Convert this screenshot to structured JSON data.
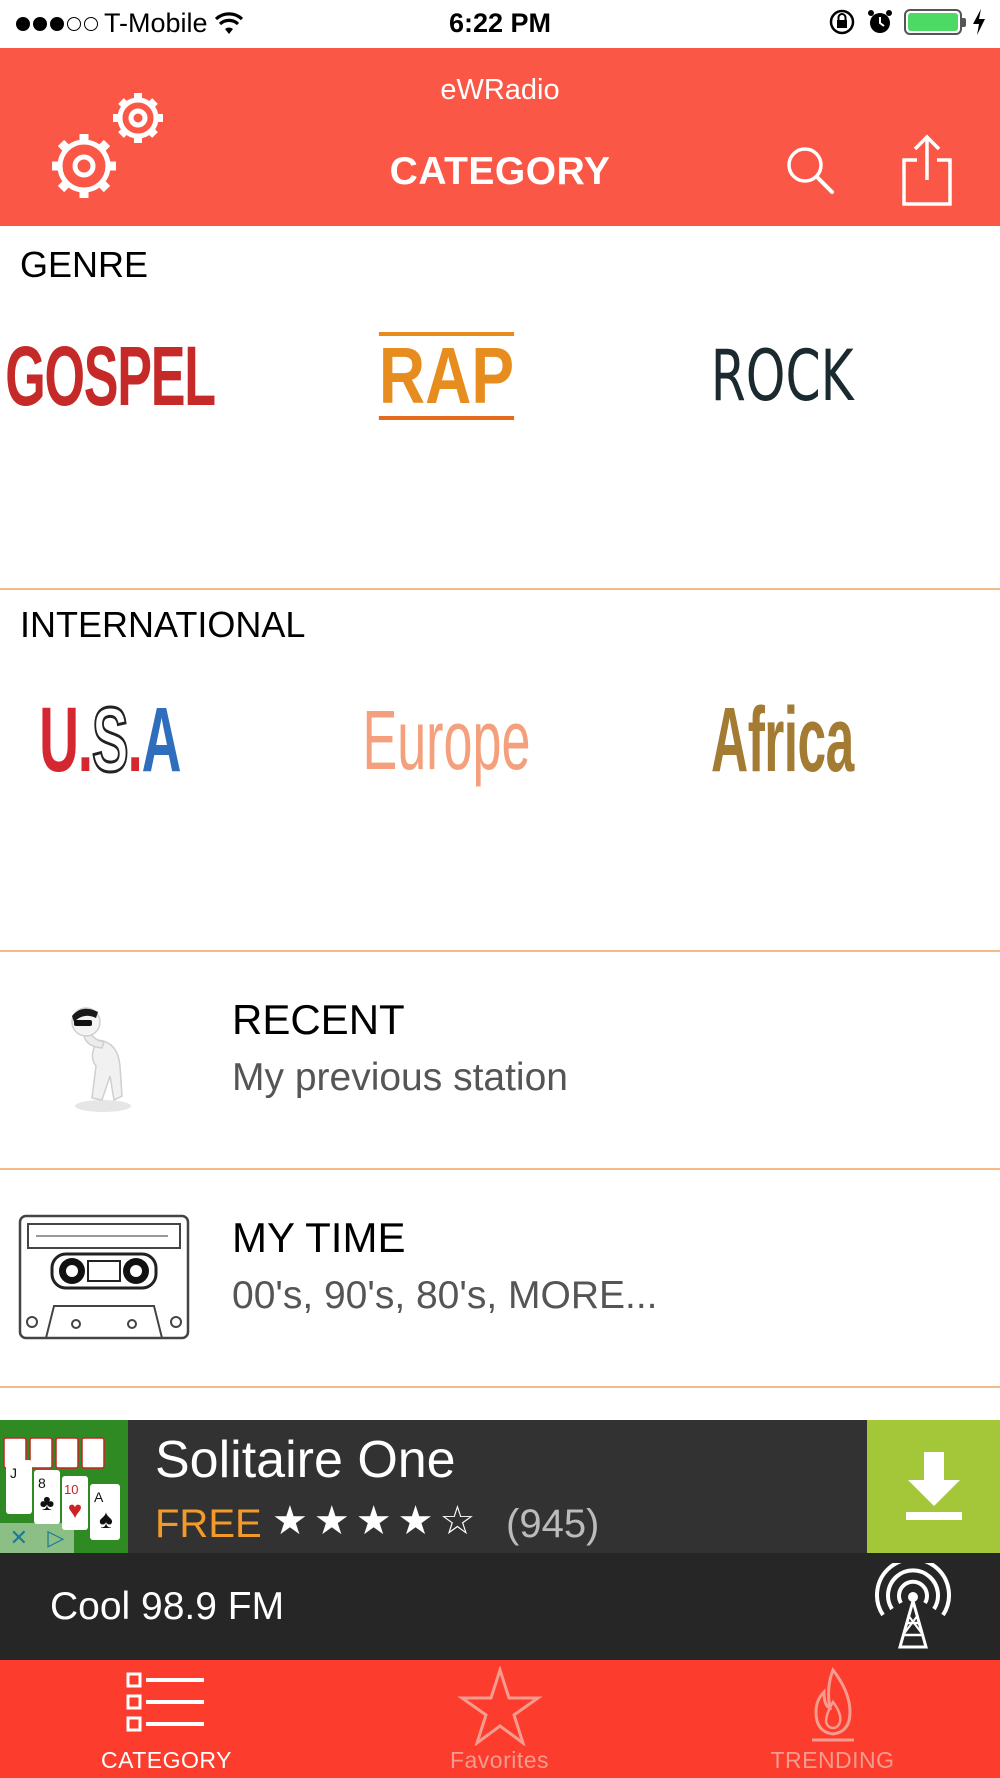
{
  "status_bar": {
    "carrier": "T-Mobile",
    "time": "6:22 PM",
    "signal_bars_filled": 3,
    "signal_bars_total": 5,
    "battery_level": 1.0
  },
  "header": {
    "app_title": "eWRadio",
    "page_title": "CATEGORY",
    "icons": [
      "gears-icon",
      "search-icon",
      "share-icon"
    ]
  },
  "genre": {
    "title": "GENRE",
    "items": [
      "GOSPEL",
      "RAP",
      "ROCK"
    ]
  },
  "international": {
    "title": "INTERNATIONAL",
    "items": [
      "Europe",
      "Africa"
    ],
    "usa": {
      "u": "U",
      "dot": ".",
      "s": "S",
      "a": "A"
    }
  },
  "recent": {
    "title": "RECENT",
    "subtitle": "My previous station"
  },
  "my_time": {
    "title": "MY TIME",
    "subtitle": "00's, 90's, 80's, MORE..."
  },
  "ad": {
    "title": "Solitaire One",
    "price": "FREE",
    "stars": "★★★★☆",
    "rating": 4.5,
    "count": "(945)"
  },
  "player": {
    "station": "Cool 98.9 FM"
  },
  "tabs": [
    {
      "label": "CATEGORY",
      "active": true
    },
    {
      "label": "Favorites",
      "active": false
    },
    {
      "label": "TRENDING",
      "active": false
    }
  ],
  "colors": {
    "header": "#fa5746",
    "tabbar": "#fc3c2c",
    "divider": "#f5b988",
    "ad_download": "#a4c639",
    "player": "#262626"
  }
}
